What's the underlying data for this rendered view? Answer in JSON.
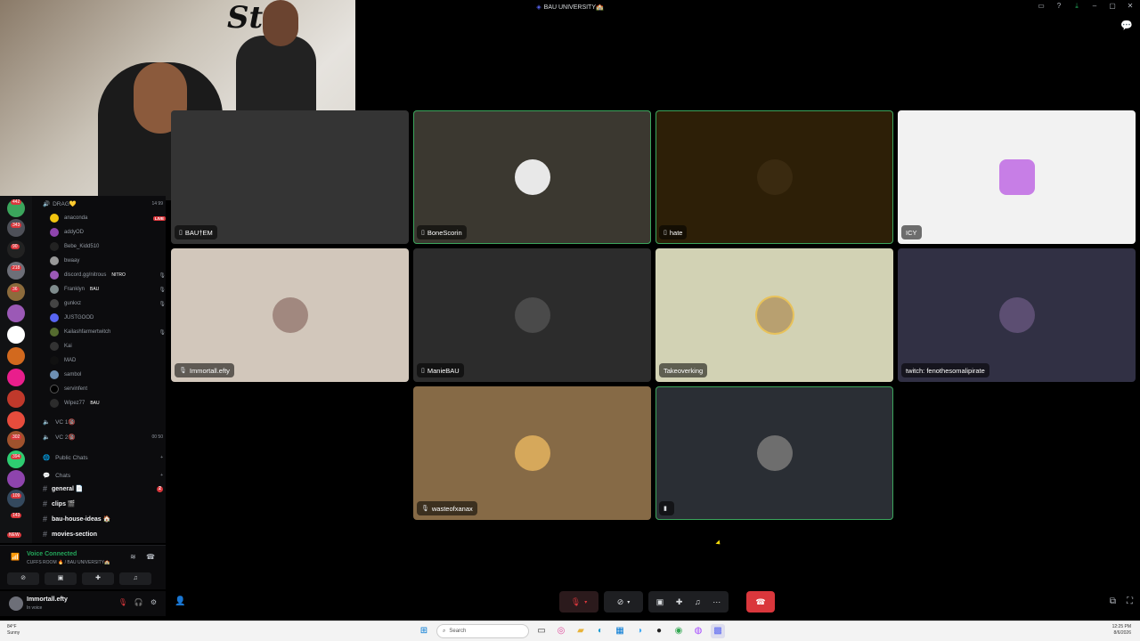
{
  "window": {
    "title": "BAU UNIVERSITY🏫",
    "controls": [
      "inbox-icon",
      "help-icon",
      "download-icon",
      "minimize-icon",
      "maximize-icon",
      "close-icon"
    ]
  },
  "server_rail": {
    "badges": [
      "442",
      "343",
      "90",
      "218",
      "36",
      "302",
      "394",
      "109",
      "143",
      "NEW"
    ]
  },
  "sidebar": {
    "category_drag": "DRAG💛",
    "category_drag_counts": "14  99",
    "members": [
      {
        "name": "anaconda",
        "live": "LIVE"
      },
      {
        "name": "addyOD"
      },
      {
        "name": "Bebe_Kidd510"
      },
      {
        "name": "bwaay"
      },
      {
        "name": "discord.gg/nitrous",
        "tag": "NITRO"
      },
      {
        "name": "Franklyn",
        "tag": "BAU"
      },
      {
        "name": "gunkxz"
      },
      {
        "name": "JUSTGOOD"
      },
      {
        "name": "Kailashfarmertwitch"
      },
      {
        "name": "Kai"
      },
      {
        "name": "MAD"
      },
      {
        "name": "sambol"
      },
      {
        "name": "servinfent"
      },
      {
        "name": "Wipez77",
        "tag": "BAU"
      }
    ],
    "voice_channels": [
      {
        "name": "VC 1🔞",
        "counts": ""
      },
      {
        "name": "VC 2🔞",
        "counts": "00  50"
      }
    ],
    "public_chats": "Public Chats",
    "chats": "Chats",
    "channels": [
      {
        "name": "general 📄",
        "unread": "2"
      },
      {
        "name": "clips 🎬"
      },
      {
        "name": "bau-house-ideas 🏠"
      },
      {
        "name": "movies-section"
      }
    ]
  },
  "voice_panel": {
    "status": "Voice Connected",
    "room": "CUFFS ROOM 🔥 / BAU UNIVERSITY🏫",
    "buttons": [
      "video-off",
      "screen-share",
      "activity",
      "soundboard"
    ]
  },
  "user_panel": {
    "name": "Immortall.efty",
    "status": "In voice"
  },
  "tiles": [
    {
      "name": "BAU†EM",
      "icon": "📱"
    },
    {
      "name": "BoneScorin",
      "icon": "📱"
    },
    {
      "name": "hate",
      "icon": "📱"
    },
    {
      "name": "ICY",
      "icon": ""
    },
    {
      "name": "Immortall.efty",
      "icon": "🎙"
    },
    {
      "name": "ManieBAU",
      "icon": "📱"
    },
    {
      "name": "Takeoverking",
      "icon": ""
    },
    {
      "name": "twitch: fenothesomalipirate",
      "icon": ""
    },
    {
      "name": "wasteofxanax",
      "icon": "🎙"
    },
    {
      "name": "",
      "icon": "▮"
    }
  ],
  "taskbar": {
    "weather_temp": "84°F",
    "weather_desc": "Sunny",
    "search_placeholder": "Search",
    "time": "12:25 PM",
    "date": "8/6/2026"
  }
}
